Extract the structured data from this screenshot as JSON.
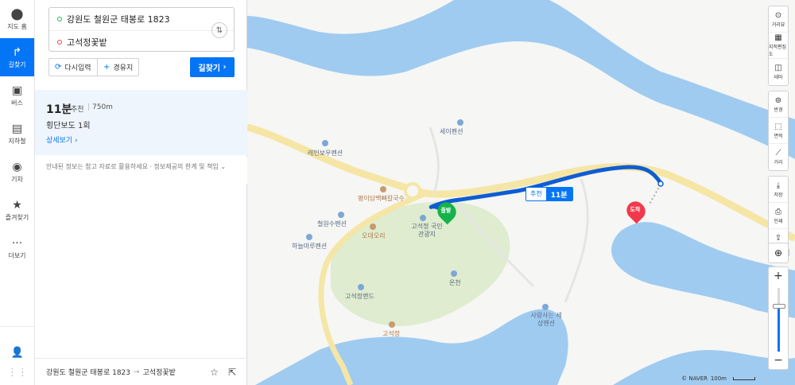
{
  "rail": [
    {
      "label": "지도 홈",
      "icon": "map-pin-icon",
      "glyph": "⬤"
    },
    {
      "label": "길찾기",
      "icon": "directions-icon",
      "glyph": "↱",
      "active": true
    },
    {
      "label": "버스",
      "icon": "bus-icon",
      "glyph": "▣"
    },
    {
      "label": "지하철",
      "icon": "subway-icon",
      "glyph": "▤"
    },
    {
      "label": "기차",
      "icon": "train-icon",
      "glyph": "◉"
    },
    {
      "label": "즐겨찾기",
      "icon": "star-icon",
      "glyph": "★"
    },
    {
      "label": "더보기",
      "icon": "more-icon",
      "glyph": "···"
    }
  ],
  "route": {
    "origin": "강원도 철원군 태봉로 1823",
    "destination": "고석정꽃밭",
    "reset_label": "다시입력",
    "waypoint_label": "경유지",
    "search_label": "길찾기"
  },
  "result": {
    "time": "11분",
    "tag": "추천",
    "divider": "|",
    "distance": "750m",
    "crosswalk": "횡단보도 1회",
    "detail_label": "상세보기"
  },
  "notice": "안내된 정보는 참고 자료로 활용하세요 · 정보제공의 한계 및 책임",
  "footer": {
    "from": "강원도 철원군 태봉로 1823",
    "to": "고석정꽃밭"
  },
  "map": {
    "labels": [
      {
        "text": "세이펜션",
        "kind": "poi"
      },
      {
        "text": "레인보우펜션",
        "kind": "poi"
      },
      {
        "text": "평이담백뼈칼국수",
        "kind": "food"
      },
      {
        "text": "고석정 국민관광지",
        "kind": "poi"
      },
      {
        "text": "철원수펜션",
        "kind": "poi"
      },
      {
        "text": "오대오리",
        "kind": "food"
      },
      {
        "text": "하늘마루펜션",
        "kind": "poi"
      },
      {
        "text": "온천",
        "kind": "poi"
      },
      {
        "text": "고석정랜드",
        "kind": "poi"
      },
      {
        "text": "사랑사는 세상펜션",
        "kind": "poi"
      },
      {
        "text": "고석정",
        "kind": "food"
      }
    ],
    "start_label": "출발",
    "end_label": "도착",
    "badge_tag": "추천",
    "badge_time": "11분",
    "edge_text": "대",
    "copyright": "© NAVER",
    "scale": "100m"
  },
  "tools": {
    "group1": [
      {
        "label": "거리뷰",
        "icon": "streetview-icon",
        "glyph": "⊙"
      },
      {
        "label": "지적편집도",
        "icon": "cadastral-icon",
        "glyph": "▦"
      },
      {
        "label": "테마",
        "icon": "theme-icon",
        "glyph": "◫"
      }
    ],
    "group2": [
      {
        "label": "반경",
        "icon": "radius-icon",
        "glyph": "⊚"
      },
      {
        "label": "면적",
        "icon": "area-icon",
        "glyph": "⬚"
      },
      {
        "label": "거리",
        "icon": "ruler-icon",
        "glyph": "⟋"
      }
    ],
    "group3": [
      {
        "label": "저장",
        "icon": "save-icon",
        "glyph": "⤓"
      },
      {
        "label": "인쇄",
        "icon": "print-icon",
        "glyph": "⎙"
      },
      {
        "label": "공유",
        "icon": "share-icon",
        "glyph": "⇪"
      }
    ]
  },
  "colors": {
    "accent": "#0475f4",
    "water": "#9fcbf0",
    "park": "#dfeccf",
    "road": "#f5e6a6"
  }
}
